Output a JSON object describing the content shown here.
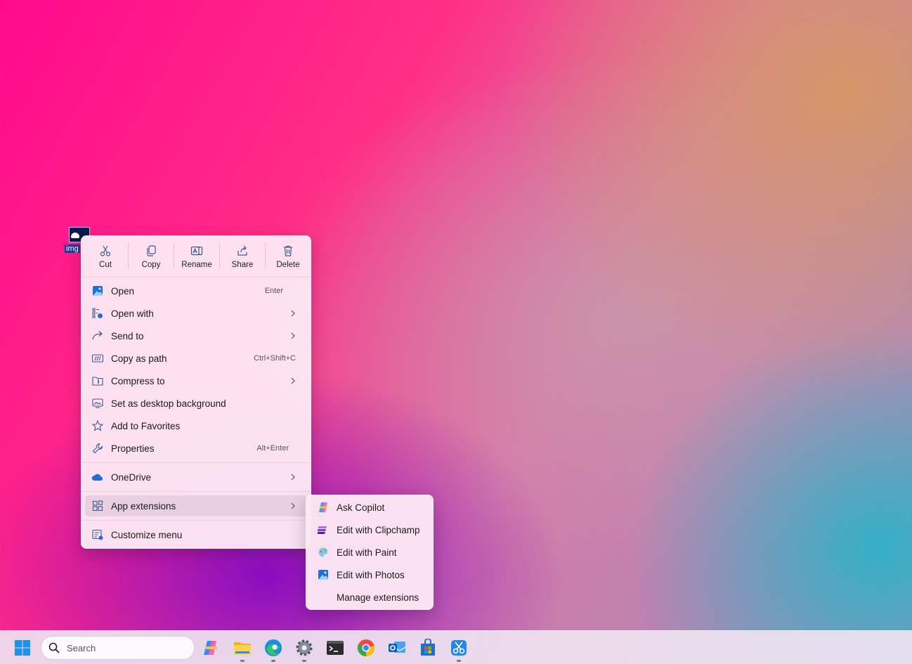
{
  "desktop": {
    "icon_label": "img"
  },
  "context_menu": {
    "toolbar": [
      {
        "label": "Cut",
        "icon": "scissors-icon"
      },
      {
        "label": "Copy",
        "icon": "copy-icon"
      },
      {
        "label": "Rename",
        "icon": "rename-icon"
      },
      {
        "label": "Share",
        "icon": "share-icon"
      },
      {
        "label": "Delete",
        "icon": "trash-icon"
      }
    ],
    "items": [
      {
        "label": "Open",
        "shortcut": "Enter",
        "icon": "photos-icon"
      },
      {
        "label": "Open with",
        "icon": "open-with-icon",
        "submenu": true
      },
      {
        "label": "Send to",
        "icon": "send-arrow-icon",
        "submenu": true
      },
      {
        "label": "Copy as path",
        "shortcut": "Ctrl+Shift+C",
        "icon": "path-icon"
      },
      {
        "label": "Compress to",
        "icon": "zip-folder-icon",
        "submenu": true
      },
      {
        "label": "Set as desktop background",
        "icon": "wallpaper-icon"
      },
      {
        "label": "Add to Favorites",
        "icon": "star-icon"
      },
      {
        "label": "Properties",
        "shortcut": "Alt+Enter",
        "icon": "wrench-icon"
      },
      {
        "label": "OneDrive",
        "icon": "onedrive-cloud-icon",
        "submenu": true
      },
      {
        "label": "App extensions",
        "icon": "app-grid-icon",
        "submenu": true,
        "active": true
      },
      {
        "label": "Customize menu",
        "icon": "customize-icon"
      }
    ]
  },
  "submenu": {
    "items": [
      {
        "label": "Ask Copilot",
        "icon": "copilot-icon"
      },
      {
        "label": "Edit with Clipchamp",
        "icon": "clipchamp-icon"
      },
      {
        "label": "Edit with Paint",
        "icon": "paint-palette-icon"
      },
      {
        "label": "Edit with Photos",
        "icon": "photos-icon"
      },
      {
        "label": "Manage extensions",
        "icon": ""
      }
    ]
  },
  "taskbar": {
    "search_placeholder": "Search",
    "apps": [
      "start-windows-icon",
      "copilot-icon",
      "file-explorer-icon",
      "edge-icon",
      "settings-gear-icon",
      "terminal-icon",
      "chrome-icon",
      "outlook-icon",
      "store-icon",
      "snipping-tool-icon"
    ]
  },
  "colors": {
    "menu_bg": "#fde7f4",
    "accent_blue": "#1e6fd8"
  }
}
